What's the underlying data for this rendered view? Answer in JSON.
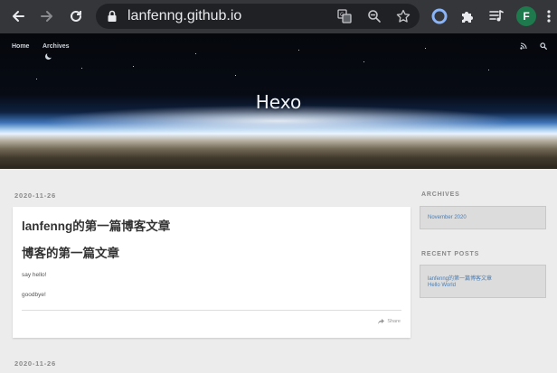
{
  "browser": {
    "url": "lanfenng.github.io",
    "profile_initial": "F",
    "icons": {
      "back": "arrow-left-icon",
      "forward": "arrow-right-icon",
      "reload": "reload-icon",
      "lock": "lock-icon",
      "translate": "translate-icon",
      "zoom": "zoom-out-icon",
      "bookmark": "star-icon",
      "extension_circle": "circle-extension-icon",
      "extensions": "puzzle-icon",
      "media": "media-queue-icon"
    }
  },
  "site": {
    "nav": [
      "Home",
      "Archives"
    ],
    "title": "Hexo",
    "header_icons": [
      "rss-icon",
      "search-icon"
    ]
  },
  "posts": [
    {
      "date": "2020-11-26",
      "title": "lanfenng的第一篇博客文章",
      "heading": "博客的第一篇文章",
      "paragraphs": [
        "say hello!",
        "goodbye!"
      ],
      "share_label": "Share"
    },
    {
      "date": "2020-11-26"
    }
  ],
  "sidebar": {
    "archives_title": "ARCHIVES",
    "archives": [
      "November 2020"
    ],
    "recent_title": "RECENT POSTS",
    "recent": [
      "lanfenng的第一篇博客文章",
      "Hello World"
    ]
  },
  "colors": {
    "chrome_bg": "#35363a",
    "omnibox_bg": "#202124",
    "page_bg": "#ececec",
    "link": "#4a7db3",
    "profile_bg": "#1e7a4d"
  }
}
